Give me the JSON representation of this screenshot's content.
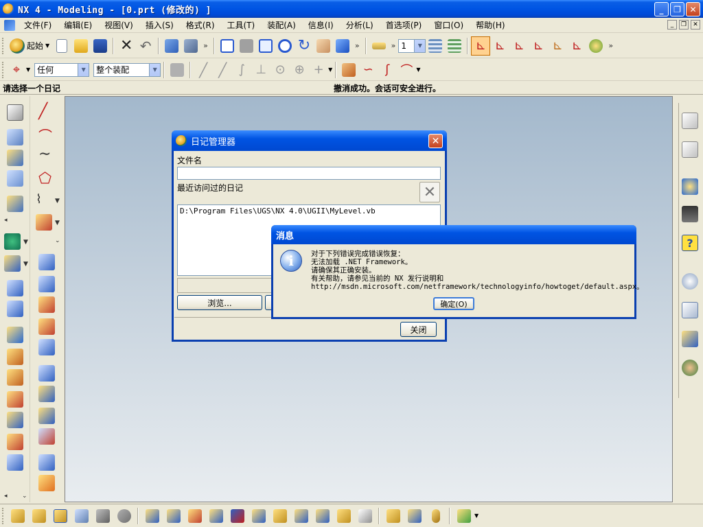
{
  "window": {
    "title": "NX 4 - Modeling - [0.prt  (修改的) ]"
  },
  "menubar": {
    "items": [
      "文件(F)",
      "编辑(E)",
      "视图(V)",
      "插入(S)",
      "格式(R)",
      "工具(T)",
      "装配(A)",
      "信息(I)",
      "分析(L)",
      "首选项(P)",
      "窗口(O)",
      "帮助(H)"
    ]
  },
  "toolbar": {
    "start_label": "起始",
    "layer_value": "1",
    "filter_value": "任何",
    "scope_value": "整个装配"
  },
  "cue_line": {
    "prompt": "请选择一个日记",
    "status": "撤消成功。会话可安全进行。"
  },
  "journal_dialog": {
    "title": "日记管理器",
    "filename_label": "文件名",
    "filename_value": "",
    "recent_label": "最近访问过的日记",
    "recent_items": [
      "D:\\Program Files\\UGS\\NX 4.0\\UGII\\MyLevel.vb"
    ],
    "browse_label": "浏览...",
    "close_label": "关闭"
  },
  "message_dialog": {
    "title": "消息",
    "lines": [
      "对于下列错误完成错误恢复：",
      "无法加载 .NET Framework。",
      "请确保其正确安装。",
      "有关帮助，请参见当前的 NX 发行说明和",
      "http://msdn.microsoft.com/netframework/technologyinfo/howtoget/default.aspx。"
    ],
    "ok_label": "确定(O)"
  }
}
